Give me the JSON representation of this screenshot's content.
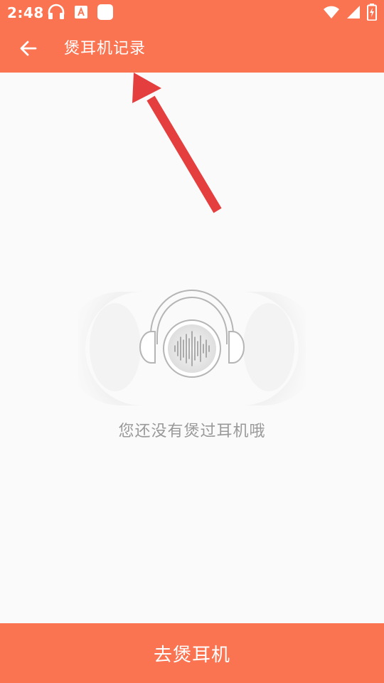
{
  "status_bar": {
    "time": "2:48",
    "left_icons": [
      "headphones-icon",
      "keyboard-a-icon",
      "app-square-icon"
    ],
    "right_icons": [
      "wifi-icon",
      "cellular-signal-icon",
      "battery-charging-icon"
    ]
  },
  "app_bar": {
    "back_icon": "arrow-left-icon",
    "title": "煲耳机记录"
  },
  "empty_state": {
    "illustration_icon": "headphones-soundwave-icon",
    "message": "您还没有煲过耳机哦"
  },
  "bottom_button": {
    "label": "去煲耳机"
  },
  "annotation": {
    "icon": "red-arrow-icon",
    "color": "#e53e3e"
  },
  "colors": {
    "primary": "#fb7452",
    "background": "#fafafa",
    "empty_text": "#999999",
    "illustration_stroke": "#b0b0b0"
  }
}
